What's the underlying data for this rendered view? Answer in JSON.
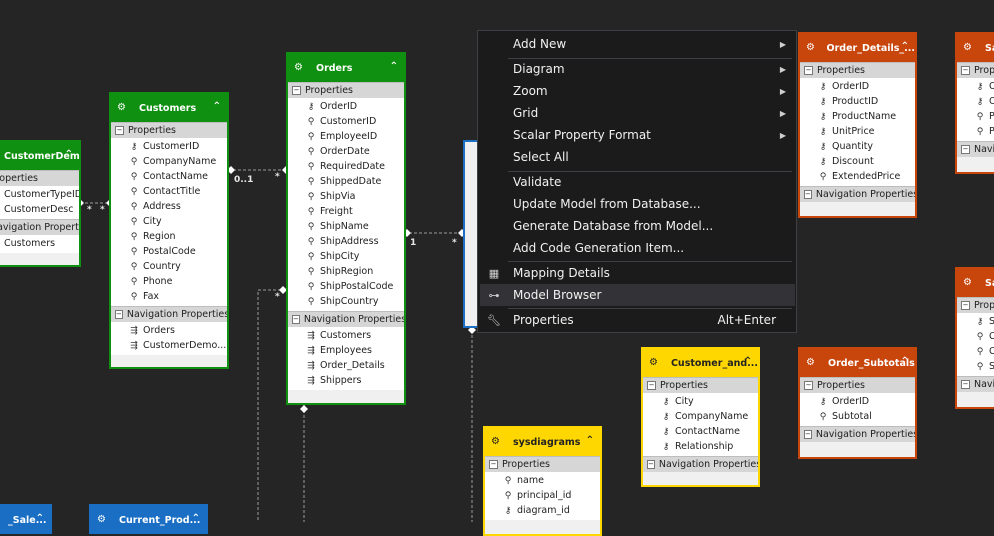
{
  "colors": {
    "green": "#109010",
    "orange": "#c8450c",
    "yellow": "#ffd700",
    "blue": "#1a6fc4",
    "background": "#252526"
  },
  "entities": {
    "customer_demographics": {
      "title": "CustomerDem...",
      "properties_label": "Properties",
      "properties": [
        "CustomerTypeID",
        "CustomerDesc"
      ],
      "nav_label": "Navigation Properties",
      "nav": [
        "Customers"
      ]
    },
    "customers": {
      "title": "Customers",
      "properties_label": "Properties",
      "properties": [
        "CustomerID",
        "CompanyName",
        "ContactName",
        "ContactTitle",
        "Address",
        "City",
        "Region",
        "PostalCode",
        "Country",
        "Phone",
        "Fax"
      ],
      "nav_label": "Navigation Properties",
      "nav": [
        "Orders",
        "CustomerDemo..."
      ]
    },
    "orders": {
      "title": "Orders",
      "properties_label": "Properties",
      "properties": [
        "OrderID",
        "CustomerID",
        "EmployeeID",
        "OrderDate",
        "RequiredDate",
        "ShippedDate",
        "ShipVia",
        "Freight",
        "ShipName",
        "ShipAddress",
        "ShipCity",
        "ShipRegion",
        "ShipPostalCode",
        "ShipCountry"
      ],
      "nav_label": "Navigation Properties",
      "nav": [
        "Customers",
        "Employees",
        "Order_Details",
        "Shippers"
      ]
    },
    "order_details": {
      "title": "Order_Details_...",
      "properties_label": "Properties",
      "properties": [
        "OrderID",
        "ProductID",
        "ProductName",
        "UnitPrice",
        "Quantity",
        "Discount",
        "ExtendedPrice"
      ],
      "nav_label": "Navigation Properties"
    },
    "sal_top": {
      "title": "Sal",
      "properties_label": "Prop",
      "properties": [
        "O",
        "O",
        "P",
        "P"
      ],
      "nav_label": "Navi"
    },
    "sal_bottom": {
      "title": "Sal",
      "properties_label": "Prop",
      "properties": [
        "S",
        "C",
        "C",
        "S"
      ],
      "nav_label": "Navi"
    },
    "customer_and": {
      "title": "Customer_and...",
      "properties_label": "Properties",
      "properties": [
        "City",
        "CompanyName",
        "ContactName",
        "Relationship"
      ],
      "nav_label": "Navigation Properties"
    },
    "order_subtotals": {
      "title": "Order_Subtotals",
      "properties_label": "Properties",
      "properties": [
        "OrderID",
        "Subtotal"
      ],
      "nav_label": "Navigation Properties"
    },
    "sysdiagrams": {
      "title": "sysdiagrams",
      "properties_label": "Properties",
      "properties": [
        "name",
        "principal_id",
        "diagram_id"
      ]
    },
    "sales_bottom": {
      "title": "_Sale..."
    },
    "current_prod": {
      "title": "Current_Prod..."
    }
  },
  "multiplicity": {
    "m1": "0..1",
    "m2": "*",
    "m3": "*",
    "m4": "*",
    "m5": "1",
    "m6": "*",
    "m7": "*"
  },
  "context_menu": {
    "add_new": "Add New",
    "diagram": "Diagram",
    "zoom": "Zoom",
    "grid": "Grid",
    "scalar_format": "Scalar Property Format",
    "select_all": "Select All",
    "validate": "Validate",
    "update_model": "Update Model from Database...",
    "generate_db": "Generate Database from Model...",
    "add_code_gen": "Add Code Generation Item...",
    "mapping_details": "Mapping Details",
    "model_browser": "Model Browser",
    "properties": "Properties",
    "properties_shortcut": "Alt+Enter"
  }
}
